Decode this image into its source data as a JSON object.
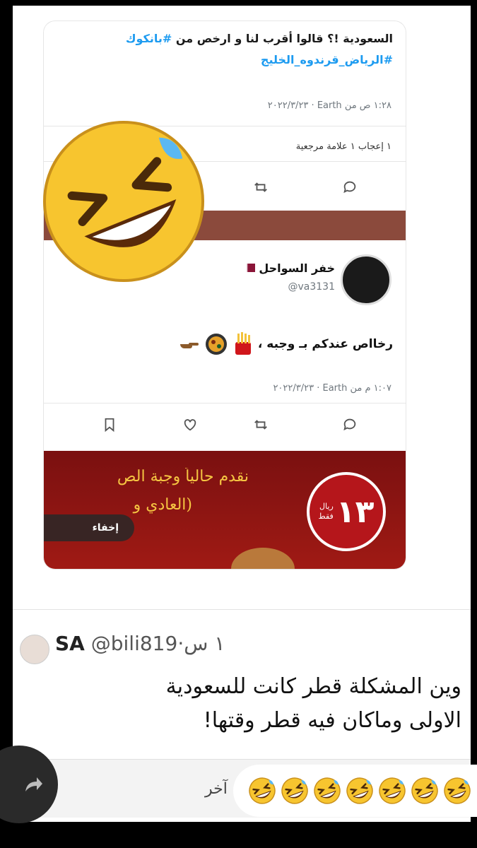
{
  "quoted_tweet": {
    "text_line1_plain": "السعودية !؟ قالوا أقرب لنا و ارخص من ",
    "text_line1_hashtag": "#بانكوك",
    "text_line2_hashtag": "#الرياض_قرندوه_الخليج",
    "timestamp": "١:٢٨ ص من Earth · ٢٠٢٢/٣/٢٣",
    "stats": "١ إعجاب  ١ علامة مرجعية"
  },
  "tweet": {
    "author_name": "خفر السواحل",
    "author_handle": "@va3131",
    "body": "رخااص عندكم بـ وجبه ،",
    "timestamp": "١:٠٧ م من Earth · ٢٠٢٢/٣/٢٣"
  },
  "promo": {
    "line1": "نقدم حالياً وجبة الص",
    "line2": "(العادي و",
    "price": "١٣",
    "currency": "ريال",
    "only": "فقط",
    "hide_label": "إخفاء"
  },
  "reply": {
    "name": "SA",
    "handle": "@bili819",
    "time": "١ س",
    "body_line1": "وين المشكلة قطر كانت للسعودية",
    "body_line2": "الاولى وماكان فيه قطر وقتها!"
  },
  "composer": {
    "placeholder": "آخر",
    "reaction_emoji": "rolling-on-floor-laughing",
    "reaction_count_shown": 7
  },
  "colors": {
    "hashtag": "#1d9bf0",
    "band": "#8b4a3c",
    "promo_red": "#a01a14",
    "price_badge": "#b5161b",
    "promo_text": "#f5c542"
  }
}
